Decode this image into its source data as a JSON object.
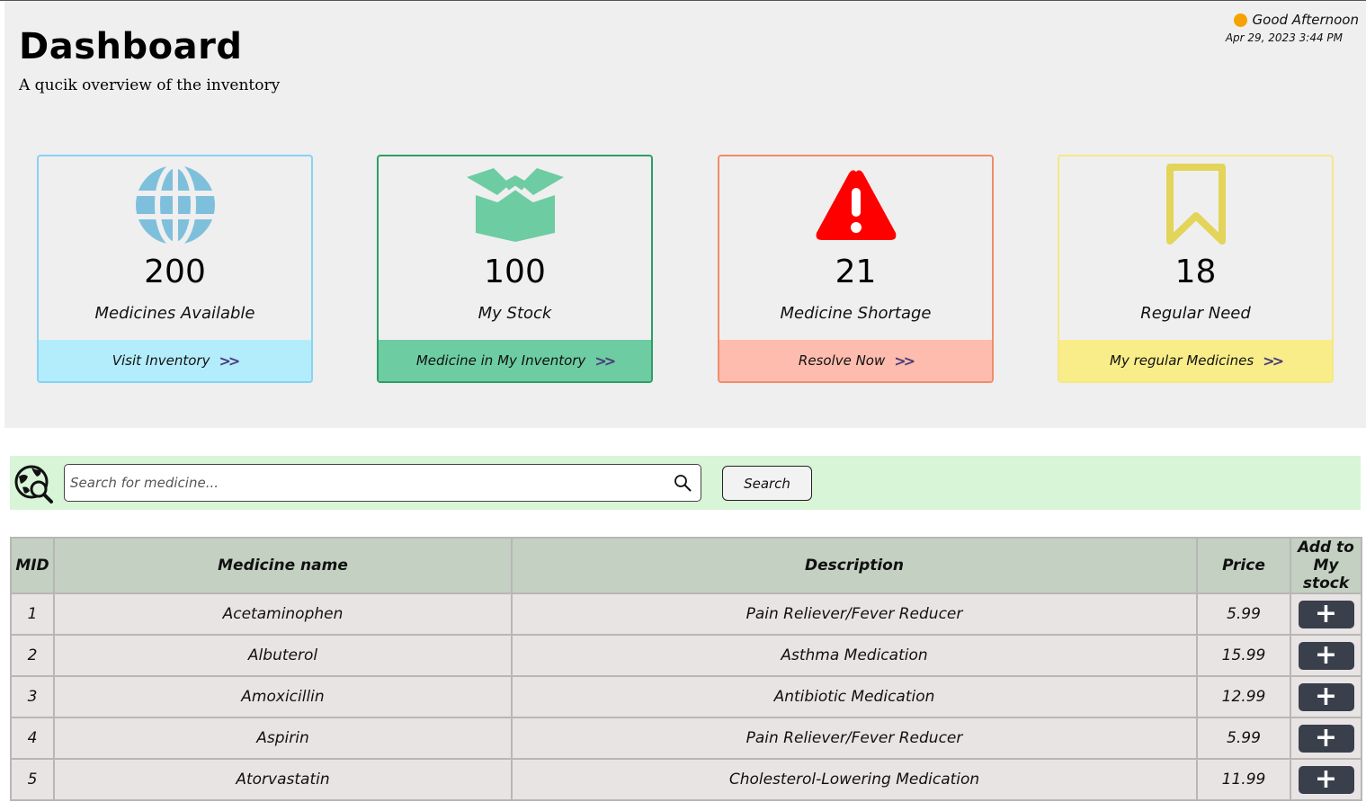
{
  "header": {
    "title": "Dashboard",
    "subtitle": "A qucik overview of the inventory",
    "greeting": "Good Afternoon",
    "datetime": "Apr 29, 2023 3:44 PM",
    "greeting_dot_color": "#f5a300"
  },
  "cards": [
    {
      "icon": "globe-icon",
      "count": "200",
      "caption": "Medicines Available",
      "footer": "Visit Inventory",
      "border": "#87d3f2",
      "footer_bg": "#b3ecfb",
      "icon_color": "#7ec0dc"
    },
    {
      "icon": "box-icon",
      "count": "100",
      "caption": "My Stock",
      "footer": "Medicine in My Inventory",
      "border": "#2e9e66",
      "footer_bg": "#6dcca2",
      "icon_color": "#6dcca2"
    },
    {
      "icon": "warning-icon",
      "count": "21",
      "caption": "Medicine Shortage",
      "footer": "Resolve Now",
      "border": "#f08c6c",
      "footer_bg": "#fdbcad",
      "icon_color": "#ff0000"
    },
    {
      "icon": "bookmark-icon",
      "count": "18",
      "caption": "Regular Need",
      "footer": "My regular Medicines",
      "border": "#f4e887",
      "footer_bg": "#f8ed88",
      "icon_color": "#e3d45a"
    }
  ],
  "search": {
    "placeholder": "Search for medicine...",
    "button_label": "Search",
    "bar_color": "#d8f5d7"
  },
  "table": {
    "headers": {
      "mid": "MID",
      "name": "Medicine name",
      "description": "Description",
      "price": "Price",
      "add_line1": "Add to",
      "add_line2": "My stock"
    },
    "rows": [
      {
        "mid": "1",
        "name": "Acetaminophen",
        "description": "Pain Reliever/Fever Reducer",
        "price": "5.99"
      },
      {
        "mid": "2",
        "name": "Albuterol",
        "description": "Asthma Medication",
        "price": "15.99"
      },
      {
        "mid": "3",
        "name": "Amoxicillin",
        "description": "Antibiotic Medication",
        "price": "12.99"
      },
      {
        "mid": "4",
        "name": "Aspirin",
        "description": "Pain Reliever/Fever Reducer",
        "price": "5.99"
      },
      {
        "mid": "5",
        "name": "Atorvastatin",
        "description": "Cholesterol-Lowering Medication",
        "price": "11.99"
      }
    ],
    "add_symbol": "+"
  }
}
